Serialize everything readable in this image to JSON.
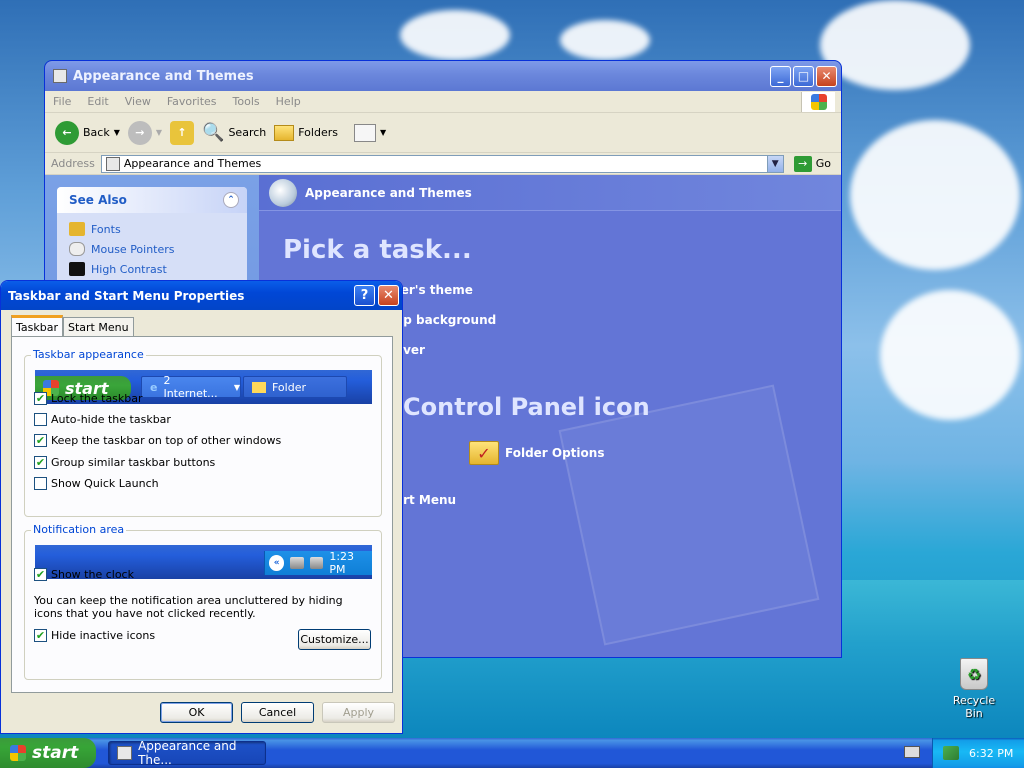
{
  "explorer": {
    "title": "Appearance and Themes",
    "menu": [
      "File",
      "Edit",
      "View",
      "Favorites",
      "Tools",
      "Help"
    ],
    "toolbar": {
      "back": "Back",
      "search": "Search",
      "folders": "Folders"
    },
    "address": {
      "label": "Address",
      "value": "Appearance and Themes",
      "go": "Go"
    },
    "see_also": {
      "title": "See Also",
      "items": [
        "Fonts",
        "Mouse Pointers",
        "High Contrast"
      ]
    },
    "category_title": "Appearance and Themes",
    "pick_task": "Pick a task...",
    "tasks": [
      "ter's theme",
      "op background",
      "aver",
      "art Menu"
    ],
    "control_panel_heading": "Control Panel icon",
    "folder_options": "Folder Options"
  },
  "dialog": {
    "title": "Taskbar and Start Menu Properties",
    "tabs": [
      "Taskbar",
      "Start Menu"
    ],
    "taskbar_appearance": {
      "label": "Taskbar appearance",
      "preview_start": "start",
      "preview_task1": "2 Internet...",
      "preview_task2": "Folder",
      "options": [
        {
          "label": "Lock the taskbar",
          "checked": true
        },
        {
          "label": "Auto-hide the taskbar",
          "checked": false
        },
        {
          "label": "Keep the taskbar on top of other windows",
          "checked": true
        },
        {
          "label": "Group similar taskbar buttons",
          "checked": true
        },
        {
          "label": "Show Quick Launch",
          "checked": false
        }
      ]
    },
    "notification_area": {
      "label": "Notification area",
      "preview_time": "1:23 PM",
      "show_clock": {
        "label": "Show the clock",
        "checked": true
      },
      "description": "You can keep the notification area uncluttered by hiding icons that you have not clicked recently.",
      "hide_inactive": {
        "label": "Hide inactive icons",
        "checked": true
      },
      "customize": "Customize..."
    },
    "buttons": {
      "ok": "OK",
      "cancel": "Cancel",
      "apply": "Apply"
    }
  },
  "taskbar": {
    "start": "start",
    "task": "Appearance and The...",
    "time": "6:32 PM"
  },
  "desktop": {
    "recycle_bin": "Recycle Bin"
  }
}
